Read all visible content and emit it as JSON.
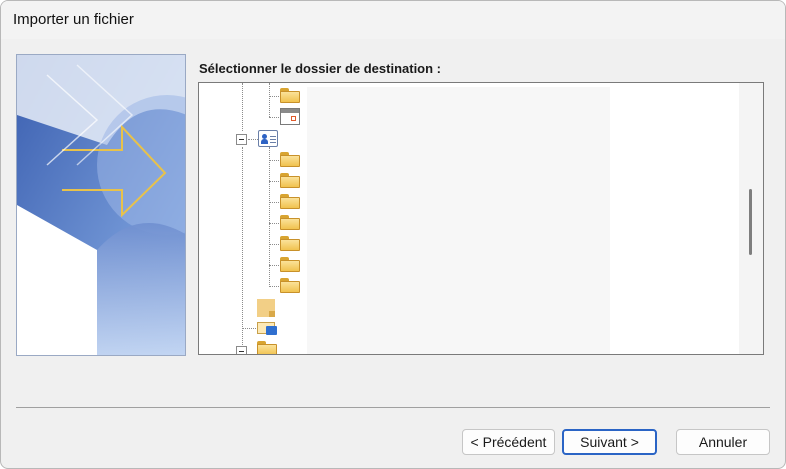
{
  "window": {
    "title": "Importer un fichier"
  },
  "prompt": "Sélectionner le dossier de destination :",
  "tree": {
    "icons": [
      "folder-icon",
      "calendar-icon",
      "contacts-icon",
      "folder-icon",
      "folder-icon",
      "folder-icon",
      "folder-icon",
      "folder-icon",
      "folder-icon",
      "folder-icon",
      "note-icon",
      "shared-folder-icon",
      "folder-icon"
    ]
  },
  "buttons": {
    "back": "< Précédent",
    "next": "Suivant >",
    "cancel": "Annuler"
  },
  "colors": {
    "accent": "#2a64c5",
    "banner_blue": "#3e64b5",
    "folder_yellow": "#f1c24f"
  }
}
